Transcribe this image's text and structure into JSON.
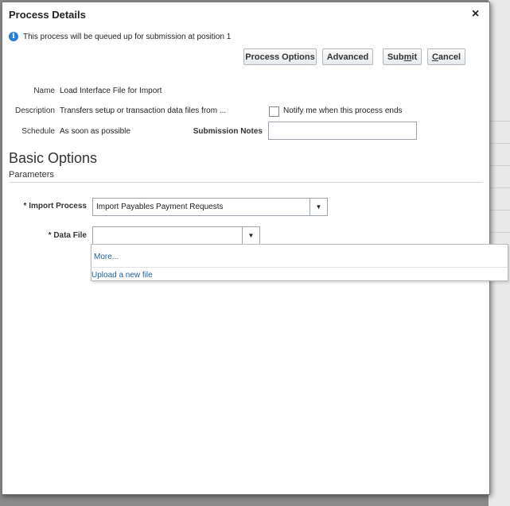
{
  "dialog": {
    "title": "Process Details",
    "close_symbol": "×",
    "info_message": "This process will be queued up for submission at position 1",
    "info_icon_glyph": "i"
  },
  "buttons": {
    "process_options": "Process Options",
    "advanced": "Advanced",
    "submit_pre": "Sub",
    "submit_u": "m",
    "submit_post": "it",
    "cancel_u": "C",
    "cancel_post": "ancel"
  },
  "details": {
    "name_label": "Name",
    "name_value": "Load Interface File for Import",
    "description_label": "Description",
    "description_value": "Transfers setup or transaction data files from ...",
    "notify_label": "Notify me when this process ends",
    "notify_checked": false,
    "schedule_label": "Schedule",
    "schedule_value": "As soon as possible",
    "submission_notes_label": "Submission Notes",
    "submission_notes_value": ""
  },
  "basic_options": {
    "heading": "Basic Options",
    "parameters_heading": "Parameters",
    "required_marker": "*",
    "import_process_label": "Import Process",
    "import_process_value": "Import Payables Payment Requests",
    "data_file_label": "Data File",
    "data_file_value": "",
    "dropdown_arrow": "▼",
    "data_file_options": [
      "More...",
      "Upload a new file"
    ]
  },
  "colors": {
    "link": "#1f5e9c",
    "info_icon": "#2a7fd4",
    "backdrop": "#8a8a8a"
  }
}
